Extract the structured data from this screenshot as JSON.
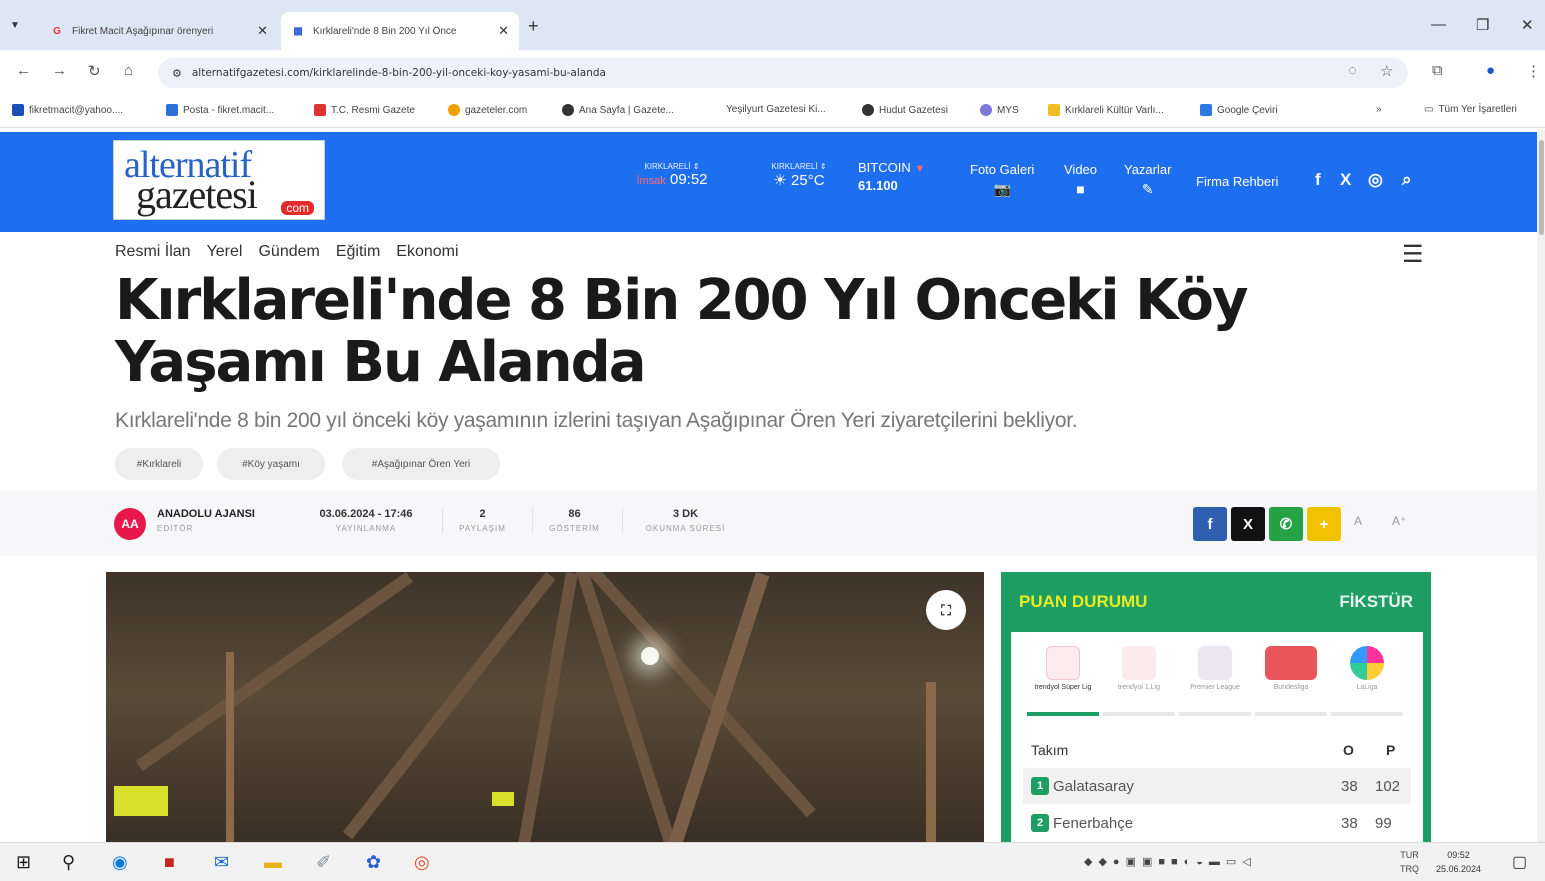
{
  "browser": {
    "tabs": [
      {
        "title": "Fikret Macit Aşağıpınar örenyeri",
        "favicon": "G"
      },
      {
        "title": "Kırklareli'nde 8 Bin 200 Yıl Önce",
        "favicon": "▦"
      }
    ],
    "url": "alternatifgazetesi.com/kirklarelinde-8-bin-200-yil-onceki-koy-yasami-bu-alanda",
    "bookmarks": [
      {
        "label": "fikretmacit@yahoo....",
        "color": "#1a4fb8"
      },
      {
        "label": "Posta - fikret.macit...",
        "color": "#2c6fd6"
      },
      {
        "label": "T.C. Resmi Gazete",
        "color": "#d33"
      },
      {
        "label": "gazeteler.com",
        "color": "#f0a000"
      },
      {
        "label": "Ana Sayfa | Gazete...",
        "color": "#333"
      },
      {
        "label": "Yeşilyurt Gazetesi Ki...",
        "color": "#fff"
      },
      {
        "label": "Hudut Gazetesi",
        "color": "#333"
      },
      {
        "label": "MYS",
        "color": "#7a7ad6"
      },
      {
        "label": "Kırklareli Kültür Varlı...",
        "color": "#f0c020"
      },
      {
        "label": "Google Çeviri",
        "color": "#2a7ae2"
      }
    ],
    "bookmarks_more": "»",
    "all_bookmarks": "Tüm Yer İşaretleri"
  },
  "header": {
    "logo_line1": "alternatif",
    "logo_line2": "gazetesi",
    "logo_tld": "com",
    "prayer_city": "KIRKLARELİ ⇕",
    "prayer_label": "İmsak",
    "prayer_time": "09:52",
    "weather_city": "KIRKLARELİ ⇕",
    "weather_temp": "25°C",
    "bitcoin_label": "BITCOIN",
    "bitcoin_value": "61.100",
    "nav": [
      {
        "label": "Foto Galeri",
        "icon": "📷"
      },
      {
        "label": "Video",
        "icon": "■"
      },
      {
        "label": "Yazarlar",
        "icon": "✎"
      }
    ],
    "firm_guide": "Firma Rehberi",
    "social": [
      "f",
      "X",
      "◎",
      "⌕"
    ]
  },
  "categories": [
    "Resmi İlan",
    "Yerel",
    "Gündem",
    "Eğitim",
    "Ekonomi"
  ],
  "article": {
    "title": "Kırklareli'nde 8 Bin 200 Yıl Onceki Köy Yaşamı Bu Alanda",
    "spot": "Kırklareli'nde 8 bin 200 yıl önceki köy yaşamının izlerini taşıyan Aşağıpınar Ören Yeri ziyaretçilerini bekliyor.",
    "tags": [
      "#Kırklareli",
      "#Köy yaşamı",
      "#Aşağıpınar Ören Yeri"
    ],
    "author_initials": "AA",
    "author": "ANADOLU AJANSI",
    "author_role": "EDİTÖR",
    "stats": [
      {
        "value": "03.06.2024 - 17:46",
        "label": "YAYINLANMA"
      },
      {
        "value": "2",
        "label": "PAYLAŞIM"
      },
      {
        "value": "86",
        "label": "GÖSTERİM"
      },
      {
        "value": "3 DK",
        "label": "OKUNMA SÜRESİ"
      }
    ],
    "share": [
      "f",
      "X",
      "✆",
      "+"
    ],
    "font_small": "A",
    "font_large": "A⁺"
  },
  "standings": {
    "title": "PUAN DURUMU",
    "fixture": "FİKSTÜR",
    "leagues": [
      "trendyol Süper Lig",
      "trendyol 1.Lig",
      "Premier League",
      "Bundesliga",
      "LaLiga"
    ],
    "col_team": "Takım",
    "col_o": "O",
    "col_p": "P",
    "rows": [
      {
        "rank": "1",
        "team": "Galatasaray",
        "o": "38",
        "p": "102"
      },
      {
        "rank": "2",
        "team": "Fenerbahçe",
        "o": "38",
        "p": "99"
      }
    ]
  },
  "taskbar": {
    "lang": "TUR",
    "lang2": "TRQ",
    "time": "09:52",
    "date": "25.06.2024"
  },
  "colors": {
    "brand_blue": "#1e6ff0",
    "widget_green": "#1e9e62",
    "accent_yellow": "#e8ec22"
  }
}
